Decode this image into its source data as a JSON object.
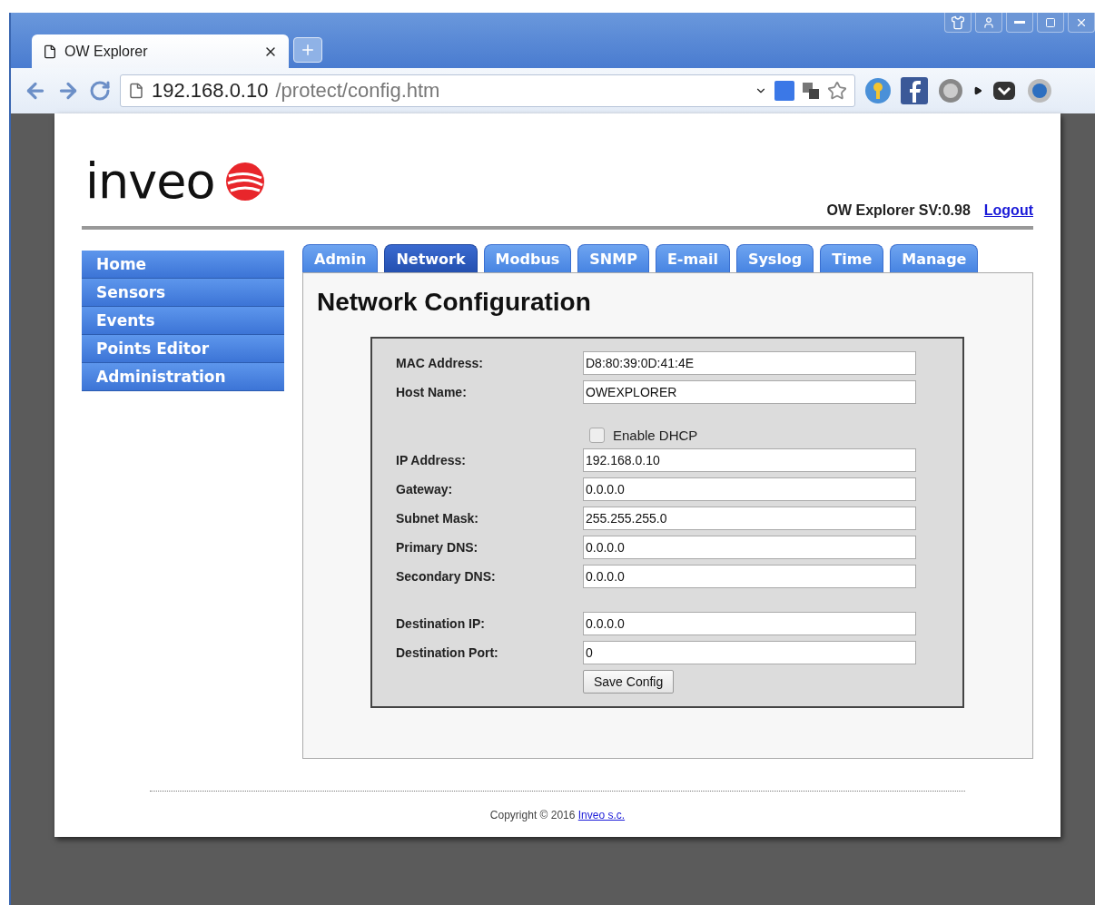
{
  "browser": {
    "tab_title": "OW Explorer",
    "url_host": "192.168.0.10",
    "url_path": "/protect/config.htm"
  },
  "header": {
    "logo": "inveo",
    "version": "OW Explorer SV:0.98",
    "logout": "Logout"
  },
  "menu": [
    {
      "label": "Home"
    },
    {
      "label": "Sensors"
    },
    {
      "label": "Events"
    },
    {
      "label": "Points Editor"
    },
    {
      "label": "Administration"
    }
  ],
  "tabs": [
    {
      "label": "Admin",
      "selected": false
    },
    {
      "label": "Network",
      "selected": true
    },
    {
      "label": "Modbus",
      "selected": false
    },
    {
      "label": "SNMP",
      "selected": false
    },
    {
      "label": "E-mail",
      "selected": false
    },
    {
      "label": "Syslog",
      "selected": false
    },
    {
      "label": "Time",
      "selected": false
    },
    {
      "label": "Manage",
      "selected": false
    }
  ],
  "heading": "Network Configuration",
  "form": {
    "sections": [
      {
        "items": [
          {
            "kind": "field",
            "label": "MAC Address:",
            "value": "D8:80:39:0D:41:4E"
          },
          {
            "kind": "field",
            "label": "Host Name:",
            "value": "OWEXPLORER"
          }
        ]
      },
      {
        "items": [
          {
            "kind": "checkbox",
            "label": "Enable DHCP",
            "checked": false
          },
          {
            "kind": "field",
            "label": "IP Address:",
            "value": "192.168.0.10"
          },
          {
            "kind": "field",
            "label": "Gateway:",
            "value": "0.0.0.0"
          },
          {
            "kind": "field",
            "label": "Subnet Mask:",
            "value": "255.255.255.0"
          },
          {
            "kind": "field",
            "label": "Primary DNS:",
            "value": "0.0.0.0"
          },
          {
            "kind": "field",
            "label": "Secondary DNS:",
            "value": "0.0.0.0"
          }
        ]
      },
      {
        "items": [
          {
            "kind": "field",
            "label": "Destination IP:",
            "value": "0.0.0.0"
          },
          {
            "kind": "field",
            "label": "Destination Port:",
            "value": "0"
          }
        ]
      }
    ],
    "save_button": "Save Config"
  },
  "footer": {
    "copyright": "Copyright © 2016 ",
    "link": "Inveo s.c."
  }
}
